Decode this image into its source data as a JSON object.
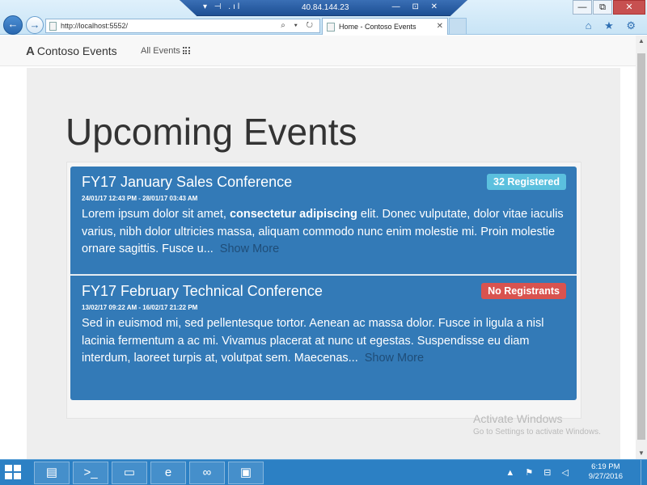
{
  "remote_bar": {
    "left_icons": "▾ ⊣ .ıl",
    "ip": "40.84.144.23",
    "controls": "— ⊡ ✕"
  },
  "browser": {
    "back_icon": "←",
    "forward_icon": "→",
    "url": "http://localhost:5552/",
    "address_controls": "⌕ ▾ ↻",
    "tab_title": "Home - Contoso Events",
    "tab_close": "✕",
    "window_controls": {
      "minimize": "—",
      "restore": "⧉",
      "close": "✕"
    },
    "tools": "⌂ ★ ⚙"
  },
  "site_nav": {
    "brand": "Contoso Events",
    "brand_icon": "A",
    "all_events": "All Events"
  },
  "page": {
    "title": "Upcoming Events"
  },
  "events": [
    {
      "title": "FY17 January Sales Conference",
      "dates": "24/01/17 12:43 PM  -  28/01/17 03:43 AM",
      "desc_before": "Lorem ipsum dolor sit amet, ",
      "desc_bold": "consectetur adipiscing",
      "desc_after": " elit. Donec vulputate, dolor vitae iaculis varius, nibh dolor ultricies massa, aliquam commodo nunc enim molestie mi. Proin molestie ornare sagittis. Fusce u...",
      "show_more": "Show More",
      "badge": "32 Registered",
      "badge_color": "#5bc0de"
    },
    {
      "title": "FY17 February Technical Conference",
      "dates": "13/02/17 09:22 AM  -  16/02/17 21:22 PM",
      "desc": "Sed in euismod mi, sed pellentesque tortor. Aenean ac massa dolor. Fusce in ligula a nisl lacinia fermentum a ac mi. Vivamus placerat at nunc ut egestas. Suspendisse eu diam interdum, laoreet turpis at, volutpat sem. Maecenas...",
      "show_more": "Show More",
      "badge": "No Registrants",
      "badge_color": "#d9534f"
    }
  ],
  "watermark": {
    "line1": "Activate Windows",
    "line2": "Go to Settings to activate Windows."
  },
  "taskbar": {
    "apps": [
      "server-manager",
      "powershell",
      "file-explorer",
      "internet-explorer",
      "visual-studio",
      "remote-desktop"
    ],
    "tray_icons": "▲ ⚑ ⊟ ◁",
    "time": "6:19 PM",
    "date": "9/27/2016"
  },
  "colors": {
    "event_bg": "#337ab7",
    "taskbar_bg": "#2c80c4"
  }
}
